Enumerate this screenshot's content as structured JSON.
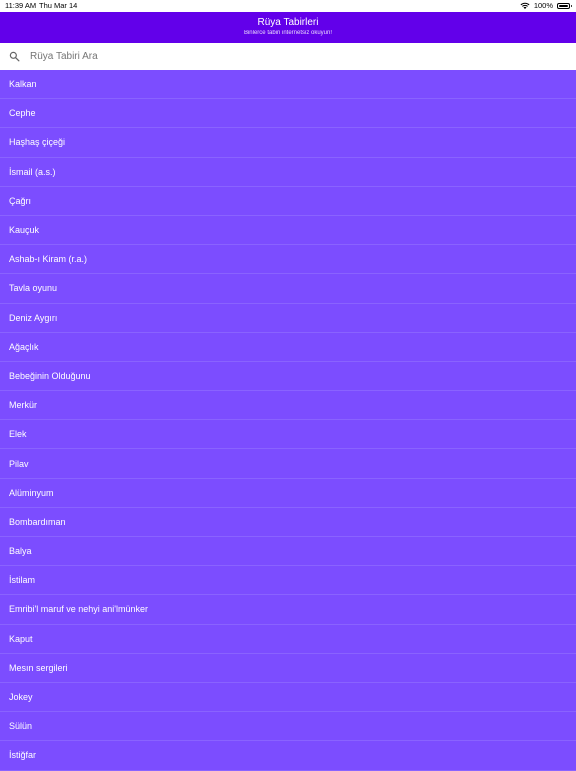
{
  "status_bar": {
    "time": "11:39 AM",
    "date": "Thu Mar 14",
    "battery": "100%"
  },
  "app_bar": {
    "title": "Rüya Tabirleri",
    "subtitle": "Binlerce tabiri internetsiz okuyun!"
  },
  "search": {
    "placeholder": "Rüya Tabiri Ara",
    "value": ""
  },
  "items": [
    "Kalkan",
    "Cephe",
    "Haşhaş çiçeği",
    "İsmail (a.s.)",
    "Çağrı",
    "Kauçuk",
    "Ashab-ı Kiram (r.a.)",
    "Tavla oyunu",
    "Deniz Aygırı",
    "Ağaçlık",
    "Bebeğinin Olduğunu",
    "Merkür",
    "Elek",
    "Pilav",
    "Alüminyum",
    "Bombardıman",
    "Balya",
    "İstilam",
    "Emribi'l maruf ve nehyi ani'lmünker",
    "Kaput",
    "Mesın sergileri",
    "Jokey",
    "Sülün",
    "İstiğfar"
  ],
  "colors": {
    "appbar": "#6200ea",
    "list_background": "#7c4dff",
    "text": "#ffffff"
  },
  "icons": {
    "search": "search-icon",
    "wifi": "wifi-icon",
    "battery": "battery-icon"
  }
}
